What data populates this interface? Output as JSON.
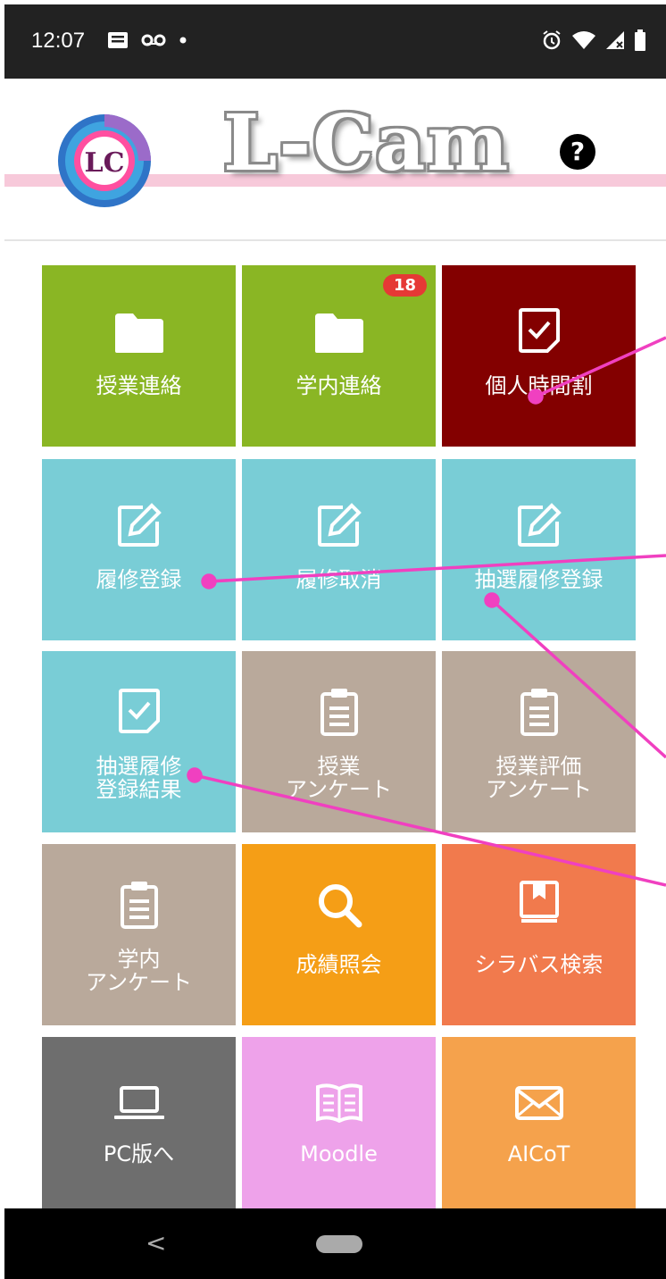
{
  "status_bar": {
    "time": "12:07"
  },
  "header": {
    "logo_text": "LC",
    "brand": "L-Cam",
    "help": "?"
  },
  "tiles": [
    {
      "label": "授業連絡",
      "icon": "folder-icon",
      "color": "#8ab624"
    },
    {
      "label": "学内連絡",
      "icon": "folder-icon",
      "color": "#8ab624",
      "badge": "18"
    },
    {
      "label": "個人時間割",
      "icon": "checkbox-icon",
      "color": "#830000"
    },
    {
      "label": "履修登録",
      "icon": "edit-icon",
      "color": "#79cdd6"
    },
    {
      "label": "履修取消",
      "icon": "edit-icon",
      "color": "#79cdd6"
    },
    {
      "label": "抽選履修登録",
      "icon": "edit-icon",
      "color": "#79cdd6"
    },
    {
      "label": "抽選履修\n登録結果",
      "icon": "checkbox-icon",
      "color": "#79cdd6"
    },
    {
      "label": "授業\nアンケート",
      "icon": "clipboard-icon",
      "color": "#b9a99b"
    },
    {
      "label": "授業評価\nアンケート",
      "icon": "clipboard-icon",
      "color": "#b9a99b"
    },
    {
      "label": "学内\nアンケート",
      "icon": "clipboard-icon",
      "color": "#b9a99b"
    },
    {
      "label": "成績照会",
      "icon": "search-icon",
      "color": "#f59e16"
    },
    {
      "label": "シラバス検索",
      "icon": "book-icon",
      "color": "#f17a4d"
    },
    {
      "label": "PC版へ",
      "icon": "laptop-icon",
      "color": "#6e6e6e"
    },
    {
      "label": "Moodle",
      "icon": "open-book-icon",
      "color": "#eea2ea"
    },
    {
      "label": "AICoT",
      "icon": "mail-icon",
      "color": "#f5a24c"
    }
  ],
  "annotation_color": "#f040c0",
  "nav": {
    "back": "<"
  }
}
